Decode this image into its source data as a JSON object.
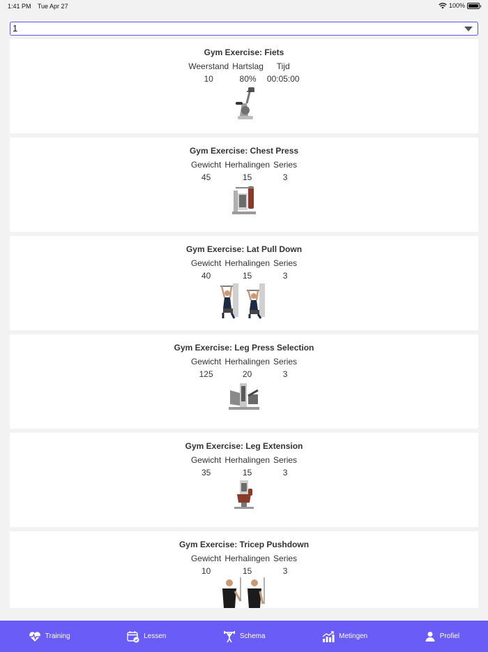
{
  "status": {
    "time": "1:41 PM",
    "date": "Tue Apr 27",
    "battery": "100%"
  },
  "selector": {
    "value": "1"
  },
  "exercises": [
    {
      "title": "Gym Exercise: Fiets",
      "columns": [
        {
          "label": "Weerstand",
          "value": "10"
        },
        {
          "label": "Hartslag",
          "value": "80%"
        },
        {
          "label": "Tijd",
          "value": "00:05:00"
        }
      ],
      "image": "exercise-bike"
    },
    {
      "title": "Gym Exercise: Chest Press",
      "columns": [
        {
          "label": "Gewicht",
          "value": "45"
        },
        {
          "label": "Herhalingen",
          "value": "15"
        },
        {
          "label": "Series",
          "value": "3"
        }
      ],
      "image": "chest-press-machine"
    },
    {
      "title": "Gym Exercise: Lat Pull Down",
      "columns": [
        {
          "label": "Gewicht",
          "value": "40"
        },
        {
          "label": "Herhalingen",
          "value": "15"
        },
        {
          "label": "Series",
          "value": "3"
        }
      ],
      "image": "lat-pull-down"
    },
    {
      "title": "Gym Exercise: Leg Press Selection",
      "columns": [
        {
          "label": "Gewicht",
          "value": "125"
        },
        {
          "label": "Herhalingen",
          "value": "20"
        },
        {
          "label": "Series",
          "value": "3"
        }
      ],
      "image": "leg-press-machine"
    },
    {
      "title": "Gym Exercise: Leg Extension",
      "columns": [
        {
          "label": "Gewicht",
          "value": "35"
        },
        {
          "label": "Herhalingen",
          "value": "15"
        },
        {
          "label": "Series",
          "value": "3"
        }
      ],
      "image": "leg-extension-machine"
    },
    {
      "title": "Gym Exercise: Tricep Pushdown",
      "columns": [
        {
          "label": "Gewicht",
          "value": "10"
        },
        {
          "label": "Herhalingen",
          "value": "15"
        },
        {
          "label": "Series",
          "value": "3"
        }
      ],
      "image": "tricep-pushdown"
    }
  ],
  "tabs": [
    {
      "label": "Training",
      "icon": "heart-pulse-icon"
    },
    {
      "label": "Lessen",
      "icon": "calendar-check-icon"
    },
    {
      "label": "Schema",
      "icon": "weightlifter-icon"
    },
    {
      "label": "Metingen",
      "icon": "chart-up-icon"
    },
    {
      "label": "Profiel",
      "icon": "person-icon"
    }
  ],
  "colors": {
    "accent": "#6a5cf6",
    "select_border": "#5b55f0",
    "background": "#f2f2f3"
  }
}
